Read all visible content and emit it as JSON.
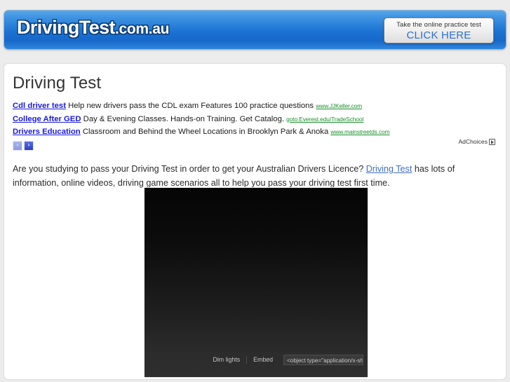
{
  "header": {
    "logo_main": "DrivingTest",
    "logo_domain": ".com.au",
    "cta_line1": "Take the online practice test",
    "cta_line2": "CLICK HERE",
    "banner_color": "#1b72d2"
  },
  "main": {
    "page_title": "Driving Test",
    "intro_before": "Are you studying to pass your Driving Test in order to get your Australian Drivers Licence? ",
    "intro_link": "Driving Test",
    "intro_after": " has lots of information, online videos, driving game scenarios all to help you pass your driving test first time."
  },
  "ads": {
    "adchoices_label": "AdChoices",
    "prev_label": "‹",
    "next_label": "›",
    "items": [
      {
        "title": "Cdl driver test",
        "description": "Help new drivers pass the CDL exam Features 100 practice questions",
        "url": "www.JJKeller.com"
      },
      {
        "title": "College After GED",
        "description": "Day & Evening Classes. Hands-on Training. Get Catalog.",
        "url": "goto.Everest.edu/TradeSchool"
      },
      {
        "title": "Drivers Education",
        "description": "Classroom and Behind the Wheel Locations in Brooklyn Park & Anoka",
        "url": "www.mainstreetds.com"
      }
    ]
  },
  "video": {
    "dim_lights_label": "Dim lights",
    "embed_label": "Embed",
    "embed_code": "<object type=\"application/x-shoc"
  }
}
